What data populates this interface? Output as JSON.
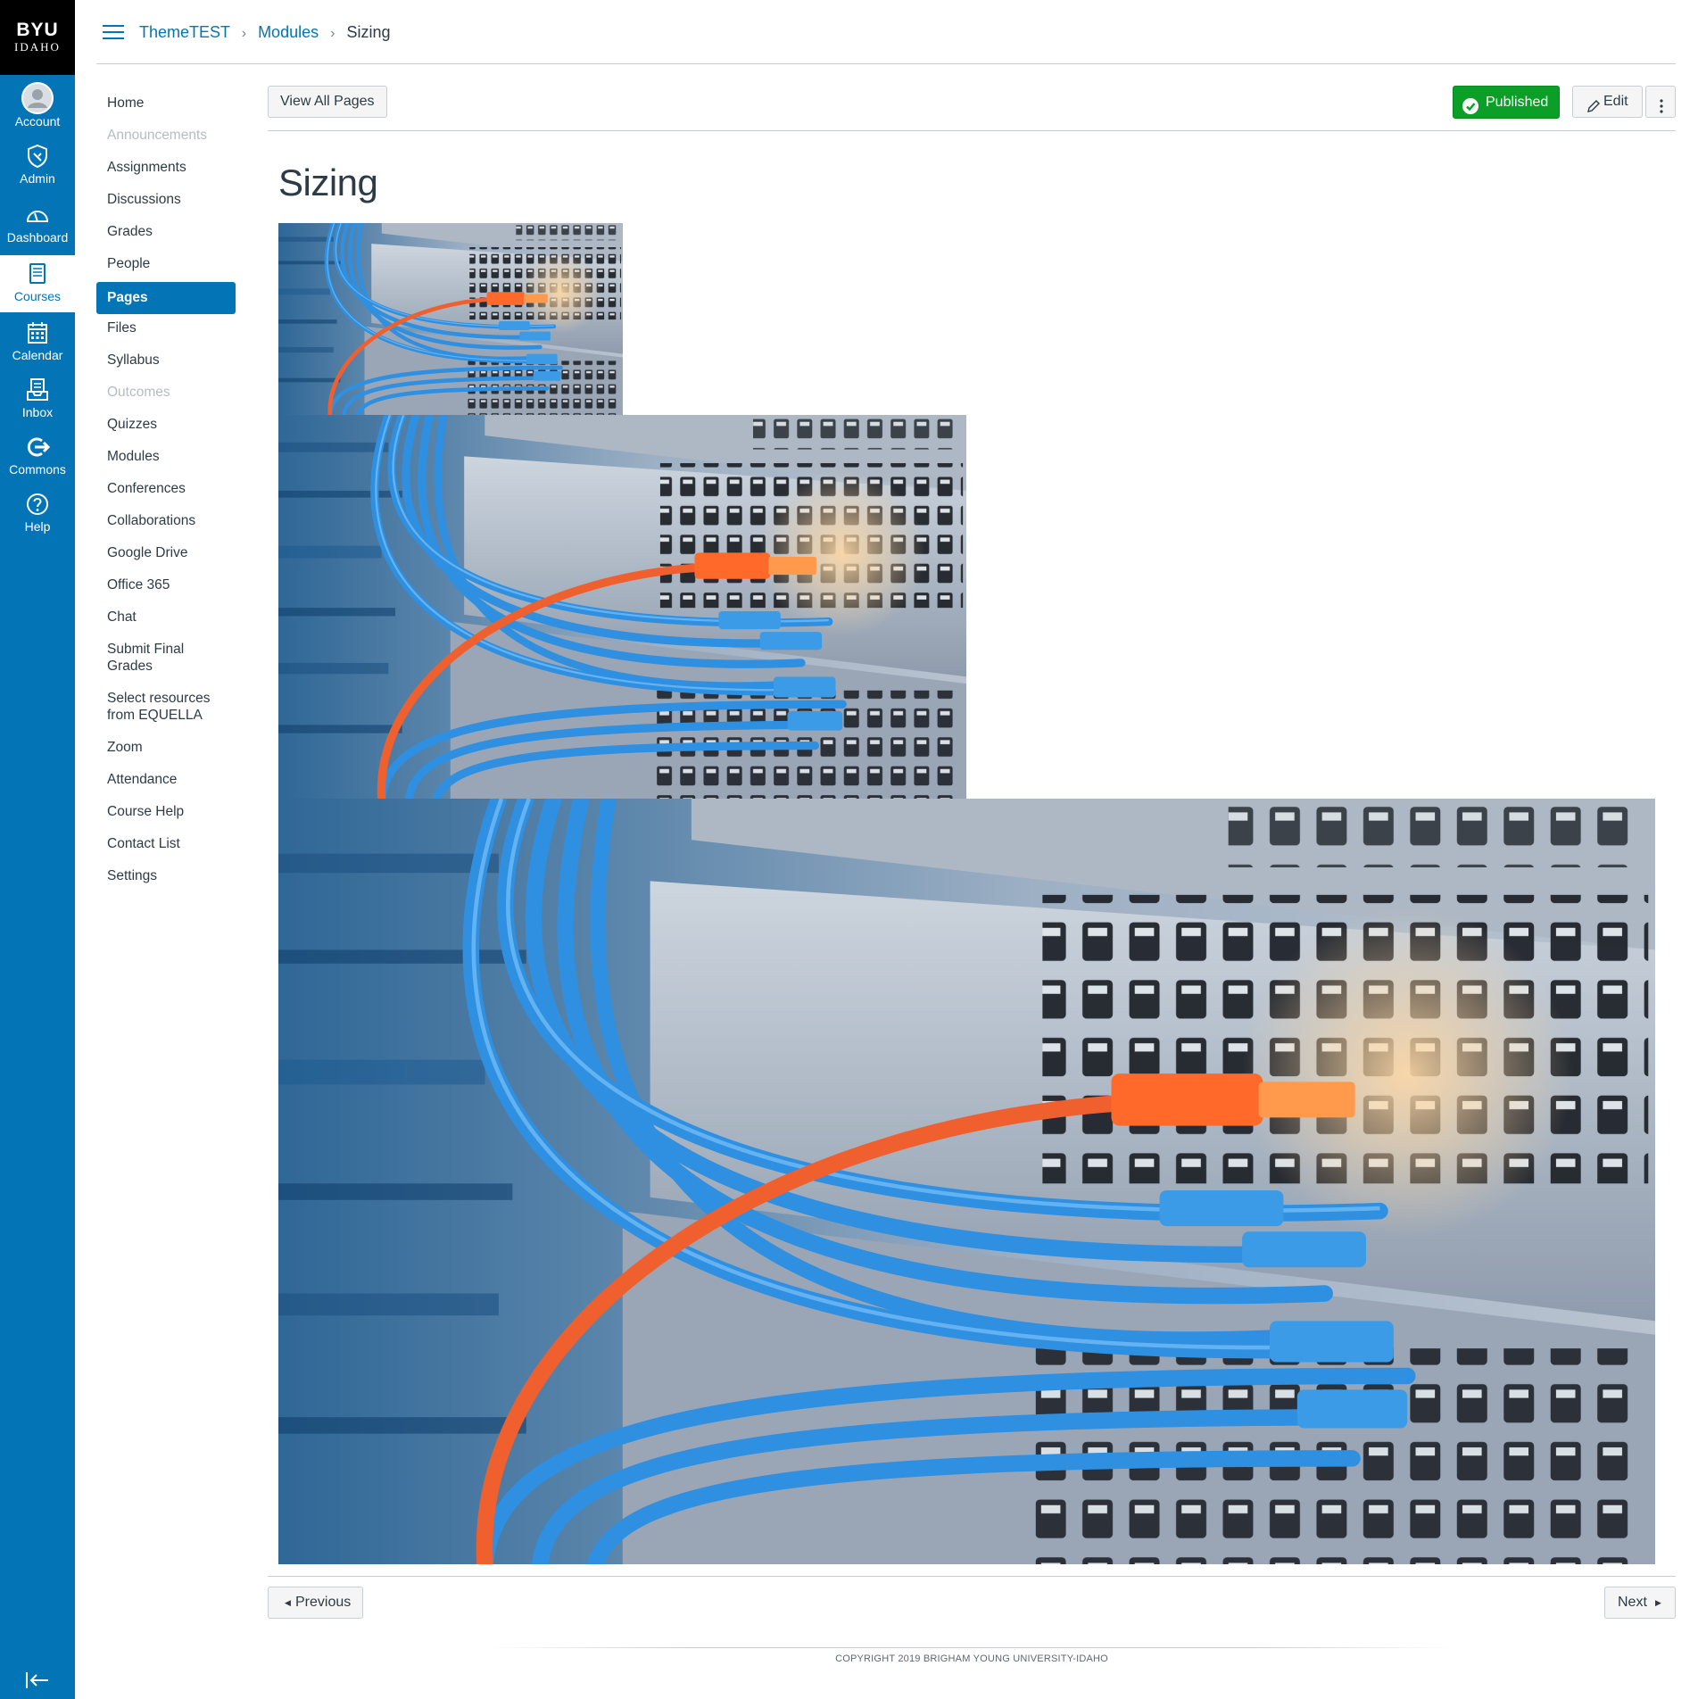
{
  "global_nav": {
    "logo_line1": "BYU",
    "logo_line2": "IDAHO",
    "items": [
      {
        "label": "Account",
        "icon": "avatar-icon"
      },
      {
        "label": "Admin",
        "icon": "shield-icon"
      },
      {
        "label": "Dashboard",
        "icon": "speedometer-icon"
      },
      {
        "label": "Courses",
        "icon": "book-icon"
      },
      {
        "label": "Calendar",
        "icon": "calendar-icon"
      },
      {
        "label": "Inbox",
        "icon": "inbox-icon"
      },
      {
        "label": "Commons",
        "icon": "commons-icon"
      },
      {
        "label": "Help",
        "icon": "help-icon"
      }
    ],
    "active": "Courses",
    "collapse_icon": "collapse-nav-icon"
  },
  "breadcrumb": {
    "items": [
      "ThemeTEST",
      "Modules",
      "Sizing"
    ],
    "separator": "›"
  },
  "course_nav": {
    "items": [
      {
        "label": "Home",
        "state": "normal"
      },
      {
        "label": "Announcements",
        "state": "disabled"
      },
      {
        "label": "Assignments",
        "state": "normal"
      },
      {
        "label": "Discussions",
        "state": "normal"
      },
      {
        "label": "Grades",
        "state": "normal"
      },
      {
        "label": "People",
        "state": "normal"
      },
      {
        "label": "Pages",
        "state": "active"
      },
      {
        "label": "Files",
        "state": "normal"
      },
      {
        "label": "Syllabus",
        "state": "normal"
      },
      {
        "label": "Outcomes",
        "state": "disabled"
      },
      {
        "label": "Quizzes",
        "state": "normal"
      },
      {
        "label": "Modules",
        "state": "normal"
      },
      {
        "label": "Conferences",
        "state": "normal"
      },
      {
        "label": "Collaborations",
        "state": "normal"
      },
      {
        "label": "Google Drive",
        "state": "normal"
      },
      {
        "label": "Office 365",
        "state": "normal"
      },
      {
        "label": "Chat",
        "state": "normal"
      },
      {
        "label": "Submit Final Grades",
        "state": "normal"
      },
      {
        "label": "Select resources from EQUELLA",
        "state": "normal"
      },
      {
        "label": "Zoom",
        "state": "normal"
      },
      {
        "label": "Attendance",
        "state": "normal"
      },
      {
        "label": "Course Help",
        "state": "normal"
      },
      {
        "label": "Contact List",
        "state": "normal"
      },
      {
        "label": "Settings",
        "state": "normal"
      }
    ]
  },
  "toolbar": {
    "view_all_label": "View All Pages",
    "published_label": "Published",
    "edit_label": "Edit",
    "more_icon": "kebab-menu-icon"
  },
  "page": {
    "title": "Sizing",
    "images": [
      "network-cables-photo-small",
      "network-cables-photo-medium",
      "network-cables-photo-large"
    ]
  },
  "pagination": {
    "previous_label": "Previous",
    "next_label": "Next"
  },
  "footer": {
    "copyright": "COPYRIGHT 2019 BRIGHAM YOUNG UNIVERSITY-IDAHO"
  },
  "colors": {
    "brand_blue": "#0374b5",
    "published_green": "#0b9f28",
    "text": "#2d3b45",
    "disabled_text": "#b4bdc4"
  }
}
